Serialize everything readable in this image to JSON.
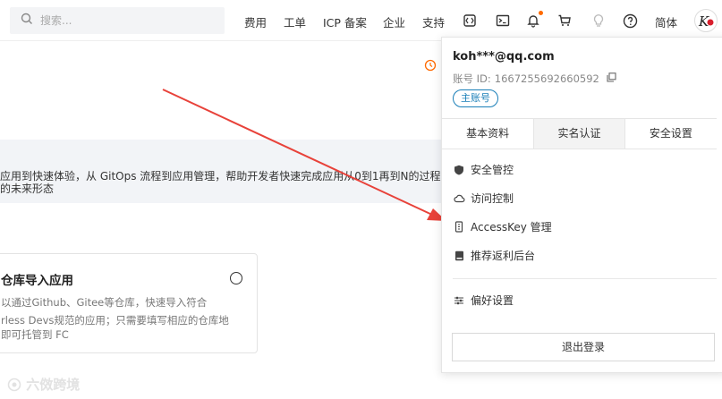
{
  "search": {
    "placeholder": "搜索..."
  },
  "nav": {
    "links": [
      "费用",
      "工单",
      "ICP 备案",
      "企业",
      "支持"
    ],
    "lang": "简体",
    "icons": [
      "code-icon",
      "terminal-icon",
      "bell-icon",
      "cart-icon",
      "bulb-icon",
      "help-icon"
    ]
  },
  "background": {
    "info_line1": "应用到快速体验，从 GitOps 流程到应用管理，帮助开发者快速完成应用从0到1再到N的过程。应",
    "info_line2": "的未来形态",
    "card": {
      "title": "仓库导入应用",
      "desc1": "以通过Github、Gitee等仓库，快速导入符合",
      "desc2": "rless Devs规范的应用；只需要填写相应的仓库地",
      "desc3": "即可托管到 FC"
    },
    "watermark": "六傚跨境"
  },
  "account": {
    "email": "koh***@qq.com",
    "id_label": "账号 ID:",
    "id_value": "1667255692660592",
    "badge": "主账号",
    "tabs": [
      "基本资料",
      "实名认证",
      "安全设置"
    ],
    "menu": [
      {
        "label": "安全管控",
        "icon": "shield-icon"
      },
      {
        "label": "访问控制",
        "icon": "cloud-icon"
      },
      {
        "label": "AccessKey 管理",
        "icon": "key-icon"
      },
      {
        "label": "推荐返利后台",
        "icon": "book-icon"
      }
    ],
    "prefs": {
      "label": "偏好设置",
      "icon": "sliders-icon"
    },
    "logout": "退出登录"
  },
  "colors": {
    "accent": "#ff6a00",
    "badge": "#1a7fb8",
    "arrow": "#e8423a"
  }
}
